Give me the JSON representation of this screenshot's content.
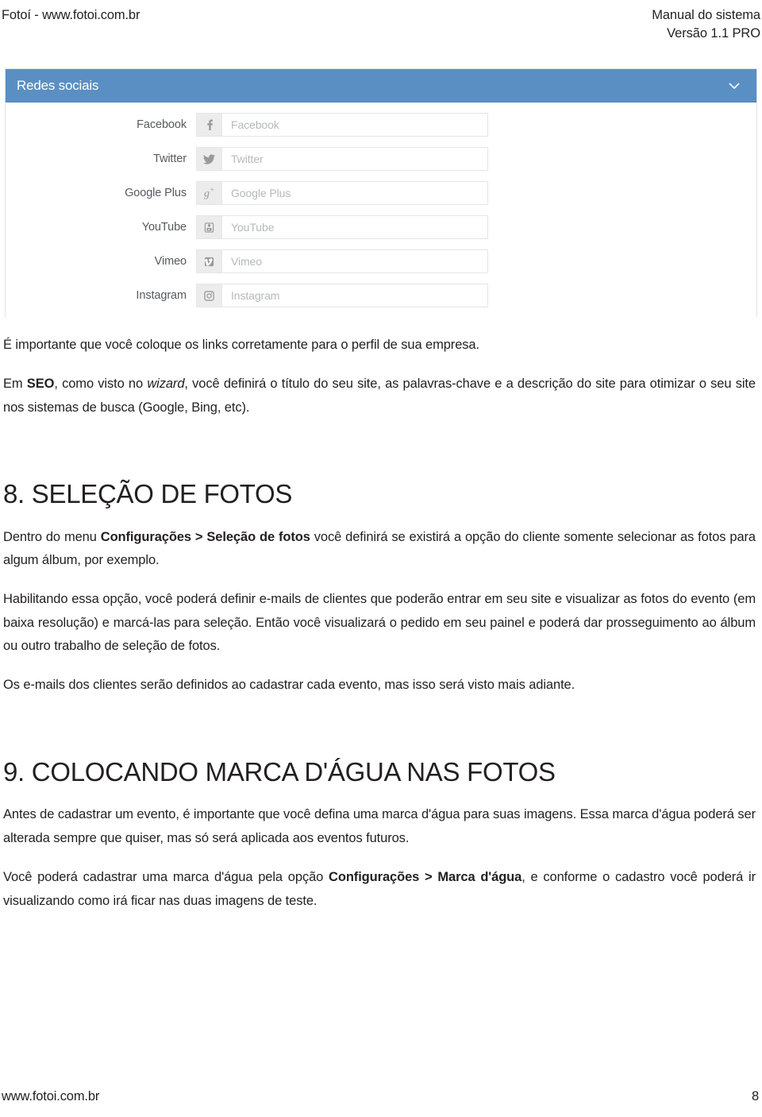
{
  "header": {
    "left": "Fotoí - www.fotoi.com.br",
    "right_line1": "Manual do sistema",
    "right_line2": "Versão 1.1 PRO"
  },
  "screenshot": {
    "panel_title": "Redes sociais",
    "collapse_icon": "chevron-down-icon",
    "fields": [
      {
        "label": "Facebook",
        "placeholder": "Facebook",
        "icon": "facebook-icon"
      },
      {
        "label": "Twitter",
        "placeholder": "Twitter",
        "icon": "twitter-icon"
      },
      {
        "label": "Google Plus",
        "placeholder": "Google Plus",
        "icon": "google-plus-icon"
      },
      {
        "label": "YouTube",
        "placeholder": "YouTube",
        "icon": "youtube-icon"
      },
      {
        "label": "Vimeo",
        "placeholder": "Vimeo",
        "icon": "vimeo-icon"
      },
      {
        "label": "Instagram",
        "placeholder": "Instagram",
        "icon": "instagram-icon"
      }
    ]
  },
  "content": {
    "p_links": "É importante que você coloque os links corretamente para o perfil de sua empresa.",
    "p_seo": {
      "a": "Em ",
      "seo": "SEO",
      "b": ", como visto no ",
      "wizard": "wizard",
      "c": ", você definirá o título do seu site, as palavras-chave e a descrição do site para otimizar o seu site nos sistemas de busca (Google, Bing, etc)."
    },
    "h_selecao": "8. SELEÇÃO DE FOTOS",
    "p_selecao_1": {
      "a": "Dentro do menu ",
      "menu": "Configurações > Seleção de fotos",
      "b": " você definirá se existirá a opção do cliente somente selecionar as fotos para algum álbum, por exemplo."
    },
    "p_selecao_2": "Habilitando essa opção, você poderá definir e-mails de clientes que poderão entrar em seu site e visualizar as fotos do evento (em baixa resolução) e marcá-las para seleção. Então você visualizará o pedido em seu painel e poderá dar prosseguimento ao álbum ou outro trabalho de seleção de fotos.",
    "p_selecao_3": "Os e-mails dos clientes serão definidos ao cadastrar cada evento, mas isso será visto mais adiante.",
    "h_marca": "9. COLOCANDO MARCA D'ÁGUA NAS FOTOS",
    "p_marca_1": "Antes de cadastrar um evento, é importante que você defina uma marca d'água para suas imagens. Essa marca d'água poderá ser alterada sempre que quiser, mas só será aplicada aos eventos futuros.",
    "p_marca_2": {
      "a": "Você poderá cadastrar uma marca d'água pela opção ",
      "menu": "Configurações > Marca d'água",
      "b": ", e conforme o cadastro você poderá ir visualizando como irá ficar nas duas imagens de teste."
    }
  },
  "footer": {
    "site": "www.fotoi.com.br",
    "page": "8"
  },
  "colors": {
    "panel_header_blue": "#5a8fc4",
    "addon_grey": "#ececec",
    "placeholder_grey": "#b6b8ba",
    "text": "#231f20"
  }
}
